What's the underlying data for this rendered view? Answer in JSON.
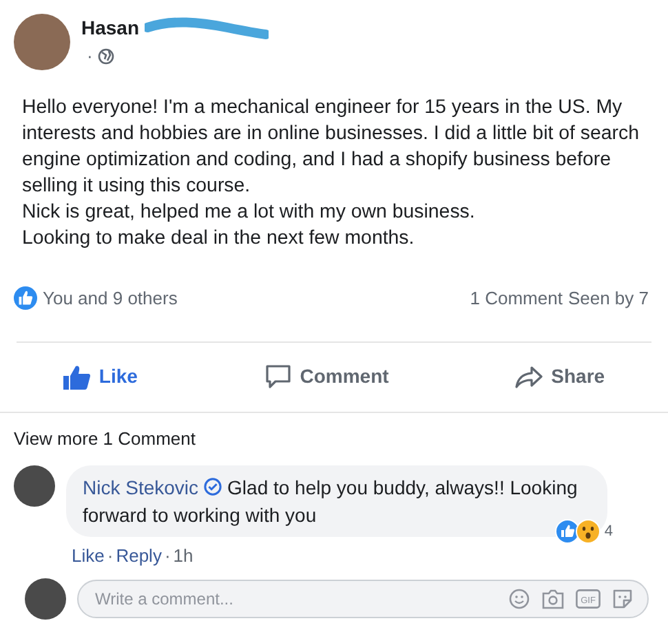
{
  "post": {
    "author": "Hasan",
    "meta": "·",
    "body": [
      "Hello everyone! I'm a mechanical engineer for 15 years in the US. My interests and hobbies are in online businesses. I did a little bit of search engine optimization and coding, and I had a shopify business before selling it using this course.",
      "Nick is great, helped me a lot with my own business.",
      "Looking to make deal in the next few months."
    ]
  },
  "reactions": {
    "summary": "You and 9 others",
    "comments": "1 Comment",
    "seen": "Seen by 7"
  },
  "actions": [
    {
      "kind": "like",
      "label": "Like",
      "selected": true
    },
    {
      "kind": "comment",
      "label": "Comment",
      "selected": false
    },
    {
      "kind": "share",
      "label": "Share",
      "selected": false
    }
  ],
  "view_more": "View more 1 Comment",
  "comment": {
    "author": "Nick Stekovic",
    "verified": true,
    "text": "Glad to help you buddy, always!! Looking forward to working with you",
    "reaction_count": "4",
    "like": "Like",
    "separator": "·",
    "reply": "Reply",
    "time": "1h"
  },
  "composer": {
    "placeholder": "Write a comment...",
    "gif_label": "GIF"
  }
}
